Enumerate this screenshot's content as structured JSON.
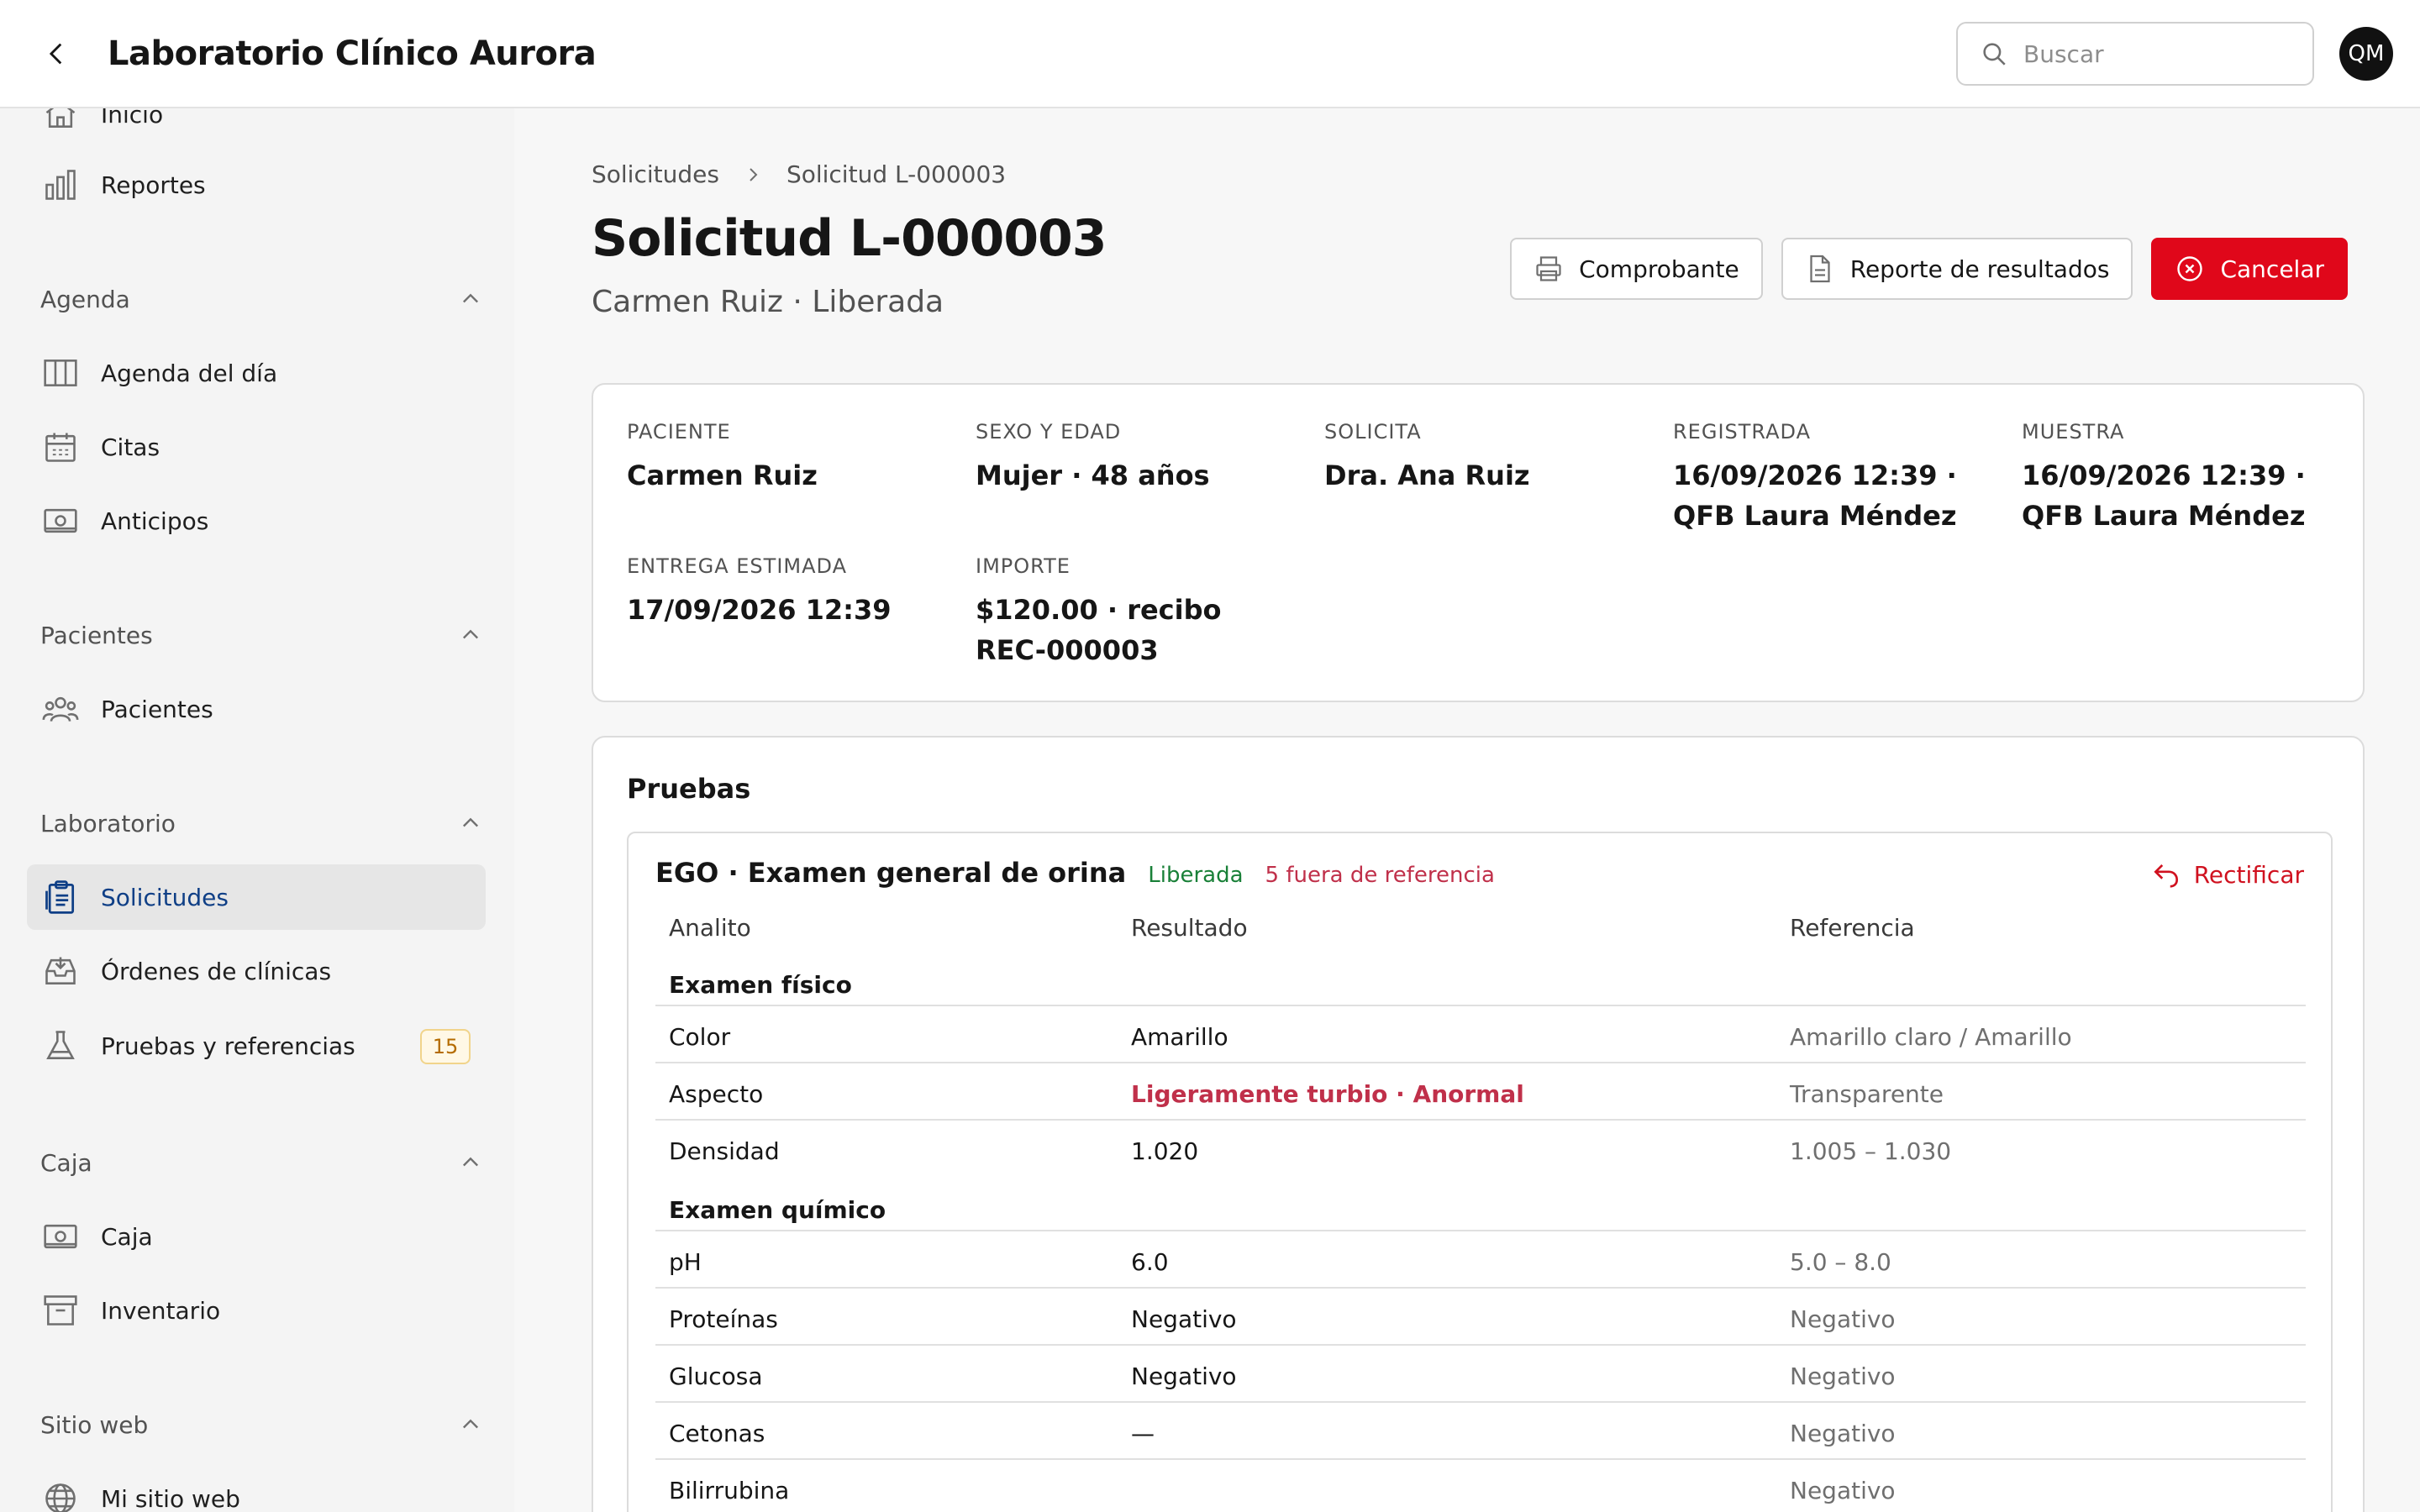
{
  "header": {
    "title": "Laboratorio Clínico Aurora",
    "search_placeholder": "Buscar",
    "avatar_initials": "QM"
  },
  "sidebar": {
    "items_top": [
      {
        "label": "Inicio",
        "icon": "home-icon"
      },
      {
        "label": "Reportes",
        "icon": "bar-chart-icon"
      }
    ],
    "sections": [
      {
        "label": "Agenda",
        "items": [
          {
            "label": "Agenda del día",
            "icon": "columns-icon"
          },
          {
            "label": "Citas",
            "icon": "calendar-icon"
          },
          {
            "label": "Anticipos",
            "icon": "cash-icon"
          }
        ]
      },
      {
        "label": "Pacientes",
        "items": [
          {
            "label": "Pacientes",
            "icon": "users-icon"
          }
        ]
      },
      {
        "label": "Laboratorio",
        "items": [
          {
            "label": "Solicitudes",
            "icon": "clipboard-icon",
            "active": true
          },
          {
            "label": "Órdenes de clínicas",
            "icon": "inbox-icon"
          },
          {
            "label": "Pruebas y referencias",
            "icon": "flask-icon",
            "badge": "15"
          }
        ]
      },
      {
        "label": "Caja",
        "items": [
          {
            "label": "Caja",
            "icon": "cash-icon"
          },
          {
            "label": "Inventario",
            "icon": "archive-icon"
          }
        ]
      },
      {
        "label": "Sitio web",
        "items": [
          {
            "label": "Mi sitio web",
            "icon": "globe-icon"
          }
        ]
      }
    ]
  },
  "breadcrumb": {
    "parent": "Solicitudes",
    "current": "Solicitud L-000003"
  },
  "page": {
    "title": "Solicitud L-000003",
    "subtitle": "Carmen Ruiz · Liberada"
  },
  "actions": {
    "receipt": "Comprobante",
    "report": "Reporte de resultados",
    "cancel": "Cancelar"
  },
  "info": {
    "patient": {
      "label": "PACIENTE",
      "value": "Carmen Ruiz"
    },
    "sex_age": {
      "label": "SEXO Y EDAD",
      "value": "Mujer · 48 años"
    },
    "requested_by": {
      "label": "SOLICITA",
      "value": "Dra. Ana Ruiz"
    },
    "registered": {
      "label": "REGISTRADA",
      "value": "16/09/2026 12:39 · QFB Laura Méndez"
    },
    "sample": {
      "label": "MUESTRA",
      "value": "16/09/2026 12:39 · QFB Laura Méndez"
    },
    "delivery": {
      "label": "ENTREGA ESTIMADA",
      "value": "17/09/2026 12:39"
    },
    "amount": {
      "label": "IMPORTE",
      "value": "$120.00 · recibo REC-000003"
    }
  },
  "tests": {
    "title": "Pruebas",
    "test": {
      "name": "EGO · Examen general de orina",
      "status": "Liberada",
      "flag": "5 fuera de referencia",
      "rectify": "Rectificar"
    },
    "columns": {
      "analyte": "Analito",
      "result": "Resultado",
      "reference": "Referencia"
    },
    "groups": [
      {
        "name": "Examen físico",
        "rows": [
          {
            "analyte": "Color",
            "result": "Amarillo",
            "reference": "Amarillo claro / Amarillo",
            "abnormal": false
          },
          {
            "analyte": "Aspecto",
            "result": "Ligeramente turbio · Anormal",
            "reference": "Transparente",
            "abnormal": true
          },
          {
            "analyte": "Densidad",
            "result": "1.020",
            "reference": "1.005 – 1.030",
            "abnormal": false
          }
        ]
      },
      {
        "name": "Examen químico",
        "rows": [
          {
            "analyte": "pH",
            "result": "6.0",
            "reference": "5.0 – 8.0",
            "abnormal": false
          },
          {
            "analyte": "Proteínas",
            "result": "Negativo",
            "reference": "Negativo",
            "abnormal": false
          },
          {
            "analyte": "Glucosa",
            "result": "Negativo",
            "reference": "Negativo",
            "abnormal": false
          },
          {
            "analyte": "Cetonas",
            "result": "—",
            "reference": "Negativo",
            "abnormal": false
          },
          {
            "analyte": "Bilirrubina",
            "result": "",
            "reference": "Negativo",
            "abnormal": false
          }
        ]
      }
    ]
  }
}
